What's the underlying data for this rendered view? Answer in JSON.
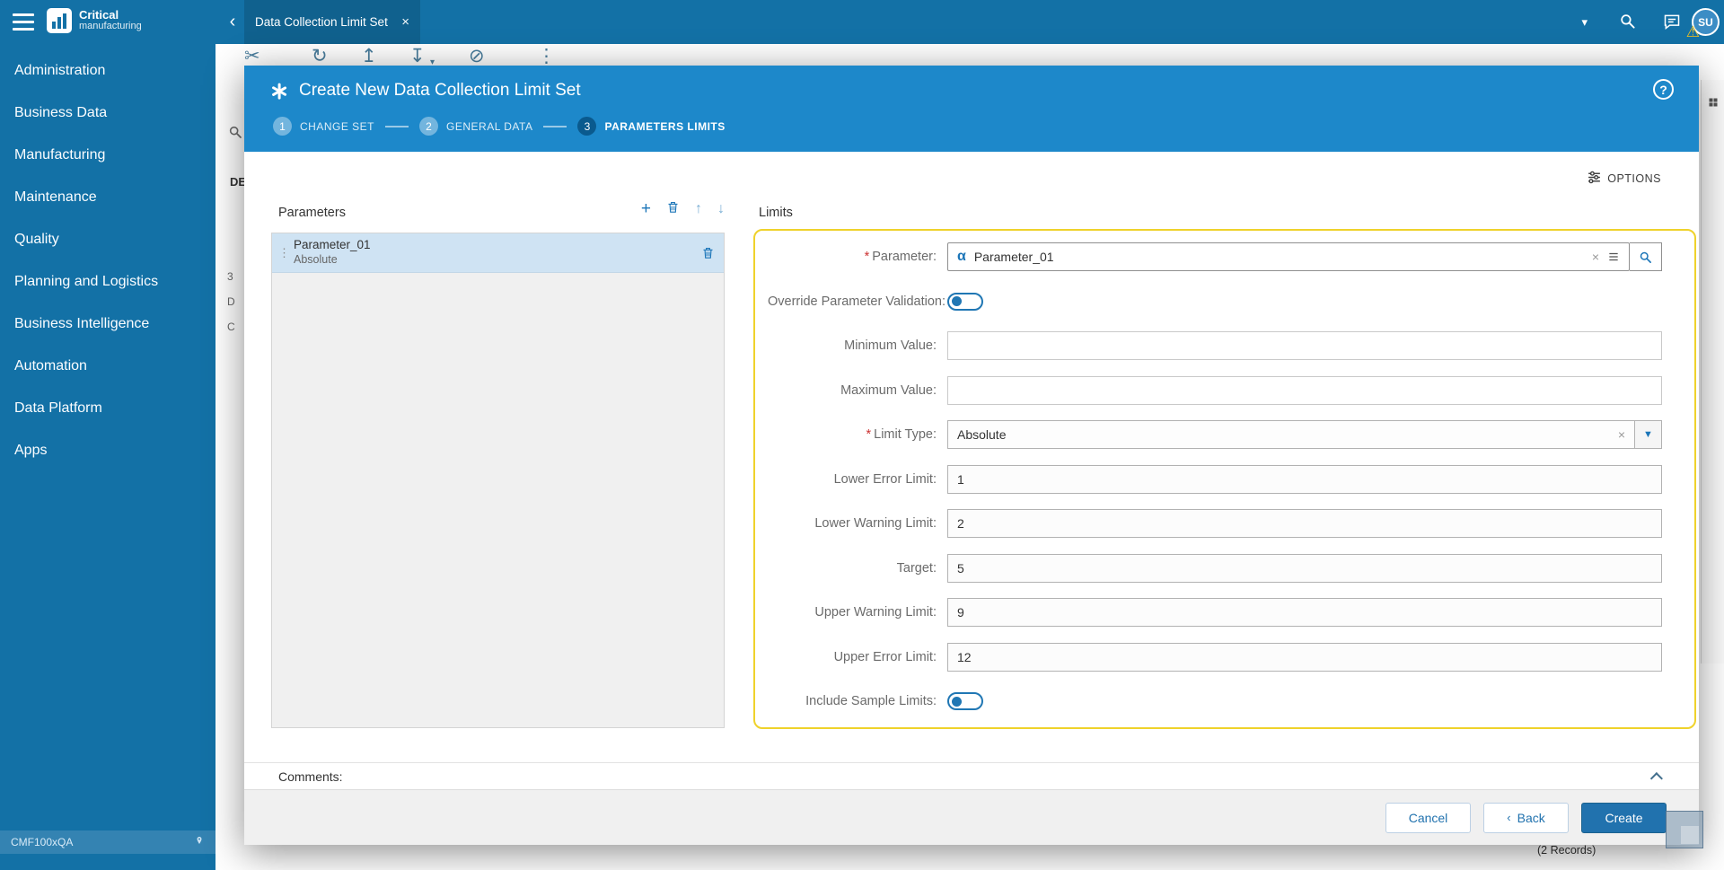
{
  "app": {
    "logo_line1": "Critical",
    "logo_line2": "manufacturing",
    "environment": "CMF100xQA"
  },
  "topbar": {
    "tab_label": "Data Collection Limit Set",
    "avatar": "SU"
  },
  "sidebar": {
    "items": [
      {
        "label": "Administration"
      },
      {
        "label": "Business Data"
      },
      {
        "label": "Manufacturing"
      },
      {
        "label": "Maintenance"
      },
      {
        "label": "Quality"
      },
      {
        "label": "Planning and Logistics"
      },
      {
        "label": "Business Intelligence"
      },
      {
        "label": "Automation"
      },
      {
        "label": "Data Platform"
      },
      {
        "label": "Apps"
      }
    ]
  },
  "page": {
    "records_count": "(2 Records)",
    "fragment_de": "DE",
    "fragment_1": "3",
    "fragment_2": "D",
    "fragment_3": "C"
  },
  "wizard": {
    "title": "Create New Data Collection Limit Set",
    "help": "?",
    "steps": [
      {
        "num": "1",
        "label": "CHANGE SET"
      },
      {
        "num": "2",
        "label": "GENERAL DATA"
      },
      {
        "num": "3",
        "label": "PARAMETERS LIMITS"
      }
    ],
    "options_label": "OPTIONS",
    "parameters": {
      "title": "Parameters",
      "selected_item": {
        "name": "Parameter_01",
        "subtitle": "Absolute"
      }
    },
    "limits": {
      "title": "Limits",
      "parameter": {
        "label": "Parameter:",
        "value": "Parameter_01"
      },
      "override_validation": {
        "label": "Override Parameter Validation:",
        "state": "off"
      },
      "minimum_value": {
        "label": "Minimum Value:",
        "value": ""
      },
      "maximum_value": {
        "label": "Maximum Value:",
        "value": ""
      },
      "limit_type": {
        "label": "Limit Type:",
        "value": "Absolute"
      },
      "lower_error": {
        "label": "Lower Error Limit:",
        "value": "1"
      },
      "lower_warning": {
        "label": "Lower Warning Limit:",
        "value": "2"
      },
      "target": {
        "label": "Target:",
        "value": "5"
      },
      "upper_warning": {
        "label": "Upper Warning Limit:",
        "value": "9"
      },
      "upper_error": {
        "label": "Upper Error Limit:",
        "value": "12"
      },
      "include_sample": {
        "label": "Include Sample Limits:",
        "state": "off"
      }
    },
    "comments_label": "Comments:",
    "buttons": {
      "cancel": "Cancel",
      "back": "Back",
      "create": "Create"
    }
  },
  "colors": {
    "sidebar_blue": "#1371a6",
    "modal_header_blue": "#1d88ca",
    "accent_blue": "#2172ae",
    "highlight_yellow": "#efd22b",
    "selected_row_blue": "#cfe3f3",
    "warning_yellow": "#f6c21c"
  }
}
